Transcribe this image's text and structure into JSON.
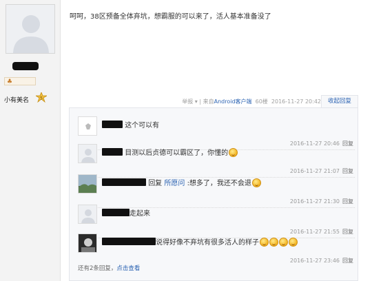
{
  "sidebar": {
    "avatar_icon": "default-user-avatar-icon",
    "level_icon": "level-badge-icon",
    "title": "小有美名",
    "medal_icon": "medal-icon"
  },
  "post": {
    "text": "呵呵，38区预备全体弃坑，想霸服的可以来了，活人基本准备没了"
  },
  "tail": {
    "report": "举报 ▾ |",
    "source_prefix": "来自",
    "source_version": "Android客户端",
    "floor": "60楼",
    "time": "2016-11-27 20:42",
    "fold": "收起回复"
  },
  "replies": [
    {
      "text": "这个可以有",
      "time": "2016-11-27 20:46",
      "reply_btn": "回复"
    },
    {
      "text": "目测以后贞德可以霸区了，你懂的",
      "time": "2016-11-27 21:07",
      "reply_btn": "回复",
      "emoji": true
    },
    {
      "reply_label": "回复",
      "reply_to": "所愿问",
      "text": ":想多了，我还不会退",
      "time": "2016-11-27 21:30",
      "reply_btn": "回复",
      "emoji": true
    },
    {
      "text": "走起来",
      "time": "2016-11-27 21:55",
      "reply_btn": "回复"
    },
    {
      "text": "说得好像不弃坑有很多活人的样子",
      "time": "2016-11-27 23:46",
      "reply_btn": "回复",
      "emoji_count": 4
    }
  ],
  "more": {
    "prefix": "还有2条回复，",
    "link": "点击查看"
  },
  "colors": {
    "link": "#2d64b3",
    "redaction": "#111111",
    "panel": "#f7f8fa"
  }
}
